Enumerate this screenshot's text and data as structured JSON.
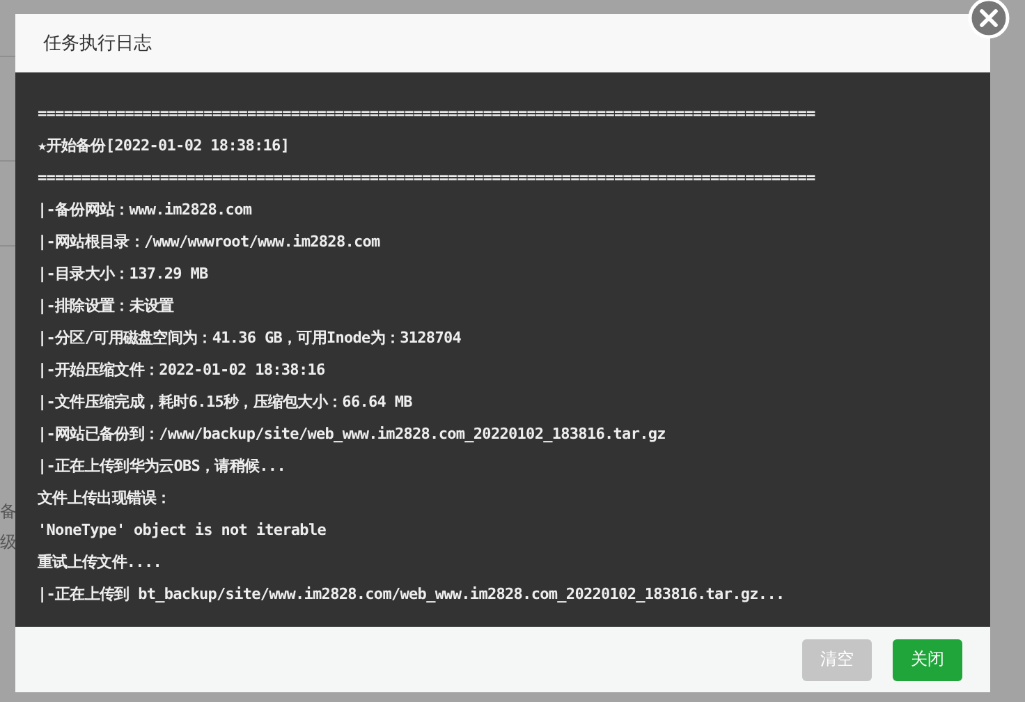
{
  "background": {
    "texts": [
      "备",
      "级"
    ]
  },
  "dialog": {
    "title": "任务执行日志",
    "log_lines": [
      "=========================================================================================",
      "★开始备份[2022-01-02 18:38:16]",
      "=========================================================================================",
      "|-备份网站：www.im2828.com",
      "|-网站根目录：/www/wwwroot/www.im2828.com",
      "|-目录大小：137.29 MB",
      "|-排除设置：未设置",
      "|-分区/可用磁盘空间为：41.36 GB，可用Inode为：3128704",
      "|-开始压缩文件：2022-01-02 18:38:16",
      "|-文件压缩完成，耗时6.15秒，压缩包大小：66.64 MB",
      "|-网站已备份到：/www/backup/site/web_www.im2828.com_20220102_183816.tar.gz",
      "|-正在上传到华为云OBS，请稍候...",
      "文件上传出现错误：",
      "'NoneType' object is not iterable",
      "重试上传文件....",
      "|-正在上传到 bt_backup/site/www.im2828.com/web_www.im2828.com_20220102_183816.tar.gz..."
    ],
    "buttons": [
      {
        "label": "清空",
        "kind": "secondary"
      },
      {
        "label": "关闭",
        "kind": "primary"
      }
    ]
  }
}
